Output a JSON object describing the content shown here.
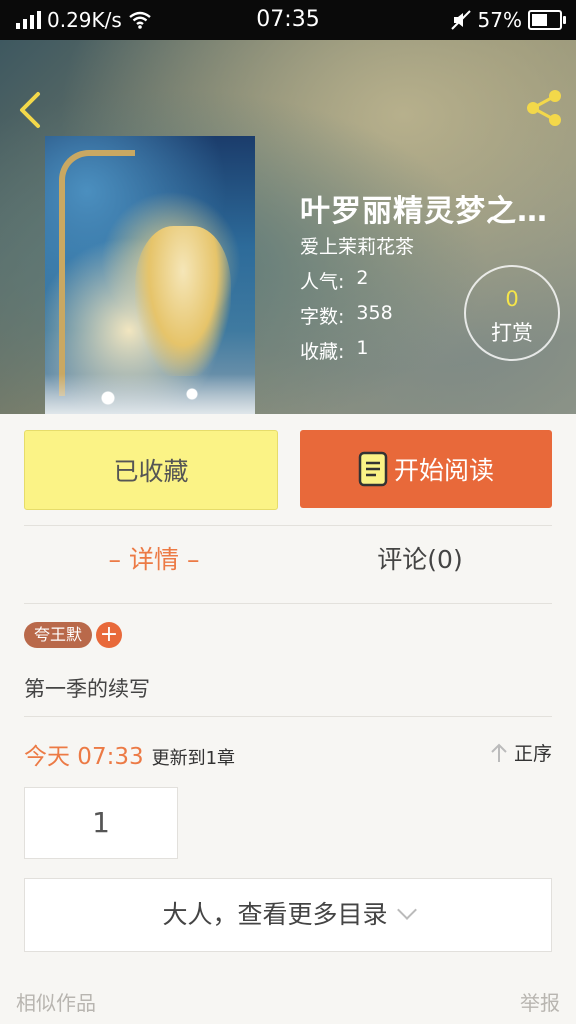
{
  "status_bar": {
    "speed": "0.29K/s",
    "time": "07:35",
    "battery": "57%",
    "battery_level": 0.57
  },
  "book": {
    "title": "叶罗丽精灵梦之灵...",
    "author": "爱上茉莉花茶",
    "popularity_label": "人气:",
    "popularity": "2",
    "words_label": "字数:",
    "words": "358",
    "favorites_label": "收藏:",
    "favorites": "1"
  },
  "tip": {
    "count": "0",
    "label": "打赏"
  },
  "actions": {
    "favorited_label": "已收藏",
    "read_label": "开始阅读"
  },
  "tabs": {
    "detail": "– 详情 –",
    "comments": "评论(0)"
  },
  "tags": [
    "夸王默"
  ],
  "tag_add": "+",
  "description": "第一季的续写",
  "update": {
    "time": "今天 07:33",
    "text": "更新到1章",
    "sort_label": "正序"
  },
  "chapters": [
    "1"
  ],
  "more_catalog": "大人，查看更多目录",
  "footer": {
    "similar": "相似作品",
    "report": "举报"
  },
  "colors": {
    "accent": "#e8693a",
    "favorite_button": "#fbf386",
    "tag": "#b9694a"
  }
}
